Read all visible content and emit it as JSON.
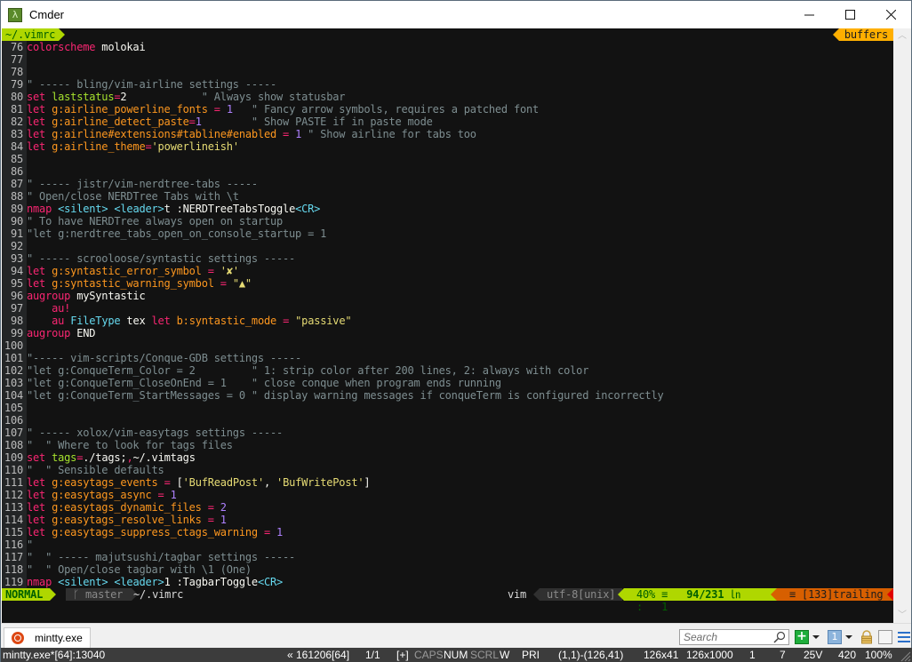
{
  "window": {
    "title": "Cmder",
    "app_icon": "lambda-icon",
    "controls": [
      "minimize",
      "maximize",
      "close"
    ]
  },
  "vim": {
    "tabline": {
      "active_tab": "~/.vimrc",
      "right_label": "buffers"
    },
    "lines": [
      {
        "n": "76",
        "segs": [
          [
            "kw",
            "colorscheme"
          ],
          [
            "white",
            " molokai"
          ]
        ]
      },
      {
        "n": "77",
        "segs": []
      },
      {
        "n": "78",
        "segs": []
      },
      {
        "n": "79",
        "segs": [
          [
            "cmt",
            "\" ----- bling/vim-airline settings -----"
          ]
        ]
      },
      {
        "n": "80",
        "segs": [
          [
            "kw",
            "set"
          ],
          [
            "white",
            " "
          ],
          [
            "opt",
            "laststatus"
          ],
          [
            "op",
            "="
          ],
          [
            "white",
            "2"
          ],
          [
            "cmt",
            "            \" Always show statusbar"
          ]
        ]
      },
      {
        "n": "81",
        "segs": [
          [
            "kw",
            "let"
          ],
          [
            "white",
            " "
          ],
          [
            "id",
            "g:airline_powerline_fonts"
          ],
          [
            "white",
            " "
          ],
          [
            "op",
            "="
          ],
          [
            "white",
            " "
          ],
          [
            "num",
            "1"
          ],
          [
            "cmt",
            "   \" Fancy arrow symbols, requires a patched font"
          ]
        ]
      },
      {
        "n": "82",
        "segs": [
          [
            "kw",
            "let"
          ],
          [
            "white",
            " "
          ],
          [
            "id",
            "g:airline_detect_paste"
          ],
          [
            "op",
            "="
          ],
          [
            "num",
            "1"
          ],
          [
            "cmt",
            "        \" Show PASTE if in paste mode"
          ]
        ]
      },
      {
        "n": "83",
        "segs": [
          [
            "kw",
            "let"
          ],
          [
            "white",
            " "
          ],
          [
            "id",
            "g:airline#extensions#tabline#enabled"
          ],
          [
            "white",
            " "
          ],
          [
            "op",
            "="
          ],
          [
            "white",
            " "
          ],
          [
            "num",
            "1"
          ],
          [
            "cmt",
            " \" Show airline for tabs too"
          ]
        ]
      },
      {
        "n": "84",
        "segs": [
          [
            "kw",
            "let"
          ],
          [
            "white",
            " "
          ],
          [
            "id",
            "g:airline_theme"
          ],
          [
            "op",
            "="
          ],
          [
            "str",
            "'powerlineish'"
          ]
        ]
      },
      {
        "n": "85",
        "segs": []
      },
      {
        "n": "86",
        "segs": []
      },
      {
        "n": "87",
        "segs": [
          [
            "cmt",
            "\" ----- jistr/vim-nerdtree-tabs -----"
          ]
        ]
      },
      {
        "n": "88",
        "segs": [
          [
            "cmt",
            "\" Open/close NERDTree Tabs with \\t"
          ]
        ]
      },
      {
        "n": "89",
        "segs": [
          [
            "kw",
            "nmap"
          ],
          [
            "white",
            " "
          ],
          [
            "sp",
            "<silent>"
          ],
          [
            "white",
            " "
          ],
          [
            "sp",
            "<leader>"
          ],
          [
            "white",
            "t :NERDTreeTabsToggle"
          ],
          [
            "sp",
            "<CR>"
          ]
        ]
      },
      {
        "n": "90",
        "segs": [
          [
            "cmt",
            "\" To have NERDTree always open on startup"
          ]
        ]
      },
      {
        "n": "91",
        "segs": [
          [
            "cmt",
            "\"let g:nerdtree_tabs_open_on_console_startup = 1"
          ]
        ]
      },
      {
        "n": "92",
        "segs": []
      },
      {
        "n": "93",
        "segs": [
          [
            "cmt",
            "\" ----- scrooloose/syntastic settings -----"
          ]
        ]
      },
      {
        "n": "94",
        "segs": [
          [
            "kw",
            "let"
          ],
          [
            "white",
            " "
          ],
          [
            "id",
            "g:syntastic_error_symbol"
          ],
          [
            "white",
            " "
          ],
          [
            "op",
            "="
          ],
          [
            "white",
            " "
          ],
          [
            "str",
            "'✘'"
          ]
        ]
      },
      {
        "n": "95",
        "segs": [
          [
            "kw",
            "let"
          ],
          [
            "white",
            " "
          ],
          [
            "id",
            "g:syntastic_warning_symbol"
          ],
          [
            "white",
            " "
          ],
          [
            "op",
            "="
          ],
          [
            "white",
            " "
          ],
          [
            "str",
            "\"▲\""
          ]
        ]
      },
      {
        "n": "96",
        "segs": [
          [
            "kw",
            "augroup"
          ],
          [
            "white",
            " mySyntastic"
          ]
        ]
      },
      {
        "n": "97",
        "segs": [
          [
            "white",
            "    "
          ],
          [
            "kw",
            "au"
          ],
          [
            "op",
            "!"
          ]
        ]
      },
      {
        "n": "98",
        "segs": [
          [
            "white",
            "    "
          ],
          [
            "kw",
            "au"
          ],
          [
            "white",
            " "
          ],
          [
            "sp",
            "FileType"
          ],
          [
            "white",
            " tex "
          ],
          [
            "kw",
            "let"
          ],
          [
            "white",
            " "
          ],
          [
            "id",
            "b:syntastic_mode"
          ],
          [
            "white",
            " "
          ],
          [
            "op",
            "="
          ],
          [
            "white",
            " "
          ],
          [
            "str",
            "\"passive\""
          ]
        ]
      },
      {
        "n": "99",
        "segs": [
          [
            "kw",
            "augroup"
          ],
          [
            "white",
            " END"
          ]
        ]
      },
      {
        "n": "100",
        "segs": []
      },
      {
        "n": "101",
        "segs": [
          [
            "cmt",
            "\"----- vim-scripts/Conque-GDB settings -----"
          ]
        ]
      },
      {
        "n": "102",
        "segs": [
          [
            "cmt",
            "\"let g:ConqueTerm_Color = 2         \" 1: strip color after 200 lines, 2: always with color"
          ]
        ]
      },
      {
        "n": "103",
        "segs": [
          [
            "cmt",
            "\"let g:ConqueTerm_CloseOnEnd = 1    \" close conque when program ends running"
          ]
        ]
      },
      {
        "n": "104",
        "segs": [
          [
            "cmt",
            "\"let g:ConqueTerm_StartMessages = 0 \" display warning messages if conqueTerm is configured incorrectly"
          ]
        ]
      },
      {
        "n": "105",
        "segs": []
      },
      {
        "n": "106",
        "segs": []
      },
      {
        "n": "107",
        "segs": [
          [
            "cmt",
            "\" ----- xolox/vim-easytags settings -----"
          ]
        ]
      },
      {
        "n": "108",
        "segs": [
          [
            "cmt",
            "\"  \" Where to look for tags files"
          ]
        ]
      },
      {
        "n": "109",
        "segs": [
          [
            "kw",
            "set"
          ],
          [
            "white",
            " "
          ],
          [
            "opt",
            "tags"
          ],
          [
            "op",
            "="
          ],
          [
            "white",
            "./tags;"
          ],
          [
            "op",
            ","
          ],
          [
            "white",
            "~/.vimtags"
          ]
        ]
      },
      {
        "n": "110",
        "segs": [
          [
            "cmt",
            "\"  \" Sensible defaults"
          ]
        ]
      },
      {
        "n": "111",
        "segs": [
          [
            "kw",
            "let"
          ],
          [
            "white",
            " "
          ],
          [
            "id",
            "g:easytags_events"
          ],
          [
            "white",
            " "
          ],
          [
            "op",
            "="
          ],
          [
            "white",
            " ["
          ],
          [
            "str",
            "'BufReadPost'"
          ],
          [
            "white",
            ", "
          ],
          [
            "str",
            "'BufWritePost'"
          ],
          [
            "white",
            "]"
          ]
        ]
      },
      {
        "n": "112",
        "segs": [
          [
            "kw",
            "let"
          ],
          [
            "white",
            " "
          ],
          [
            "id",
            "g:easytags_async"
          ],
          [
            "white",
            " "
          ],
          [
            "op",
            "="
          ],
          [
            "white",
            " "
          ],
          [
            "num",
            "1"
          ]
        ]
      },
      {
        "n": "113",
        "segs": [
          [
            "kw",
            "let"
          ],
          [
            "white",
            " "
          ],
          [
            "id",
            "g:easytags_dynamic_files"
          ],
          [
            "white",
            " "
          ],
          [
            "op",
            "="
          ],
          [
            "white",
            " "
          ],
          [
            "num",
            "2"
          ]
        ]
      },
      {
        "n": "114",
        "segs": [
          [
            "kw",
            "let"
          ],
          [
            "white",
            " "
          ],
          [
            "id",
            "g:easytags_resolve_links"
          ],
          [
            "white",
            " "
          ],
          [
            "op",
            "="
          ],
          [
            "white",
            " "
          ],
          [
            "num",
            "1"
          ]
        ]
      },
      {
        "n": "115",
        "segs": [
          [
            "kw",
            "let"
          ],
          [
            "white",
            " "
          ],
          [
            "id",
            "g:easytags_suppress_ctags_warning"
          ],
          [
            "white",
            " "
          ],
          [
            "op",
            "="
          ],
          [
            "white",
            " "
          ],
          [
            "num",
            "1"
          ]
        ]
      },
      {
        "n": "116",
        "segs": [
          [
            "cmt",
            "\""
          ]
        ]
      },
      {
        "n": "117",
        "segs": [
          [
            "cmt",
            "\"  \" ----- majutsushi/tagbar settings -----"
          ]
        ]
      },
      {
        "n": "118",
        "segs": [
          [
            "cmt",
            "\"  \" Open/close tagbar with \\1 (One)"
          ]
        ]
      },
      {
        "n": "119",
        "segs": [
          [
            "kw",
            "nmap"
          ],
          [
            "white",
            " "
          ],
          [
            "sp",
            "<silent>"
          ],
          [
            "white",
            " "
          ],
          [
            "sp",
            "<leader>"
          ],
          [
            "white",
            "1 :TagbarToggle"
          ],
          [
            "sp",
            "<CR>"
          ]
        ]
      }
    ],
    "statusline": {
      "mode": "NORMAL",
      "branch_icon": "git-branch-icon",
      "branch": "master",
      "file": "~/.vimrc",
      "filetype": "vim",
      "encoding": "utf-8[unix]",
      "percent": "40% ≡",
      "position": "94/231",
      "line_icon": "㏑",
      "column_sep": ":",
      "column": "1",
      "warning": "≡ [133]trailing"
    }
  },
  "tabbar": {
    "console_tab_label": "mintty.exe",
    "console_tab_icon": "ubuntu-icon",
    "search_placeholder": "Search",
    "buttons": [
      "new-console",
      "new-console-dropdown",
      "tab-one",
      "tab-dropdown",
      "lock",
      "split",
      "menu"
    ],
    "one_label": "1"
  },
  "statusbar": {
    "process": "mintty.exe*[64]:13040",
    "pid_info": "« 161206[64]",
    "page": "1/1",
    "plus": "[+]",
    "caps": "CAPS",
    "num": "NUM",
    "scrl": "SCRL",
    "w": "W",
    "pri": "PRI",
    "selection": "(1,1)-(126,41)",
    "size": "126x41",
    "buffer": "126x1000",
    "v1": "1",
    "v2": "7",
    "v3": "25V",
    "v4": "420",
    "zoom": "100%"
  }
}
